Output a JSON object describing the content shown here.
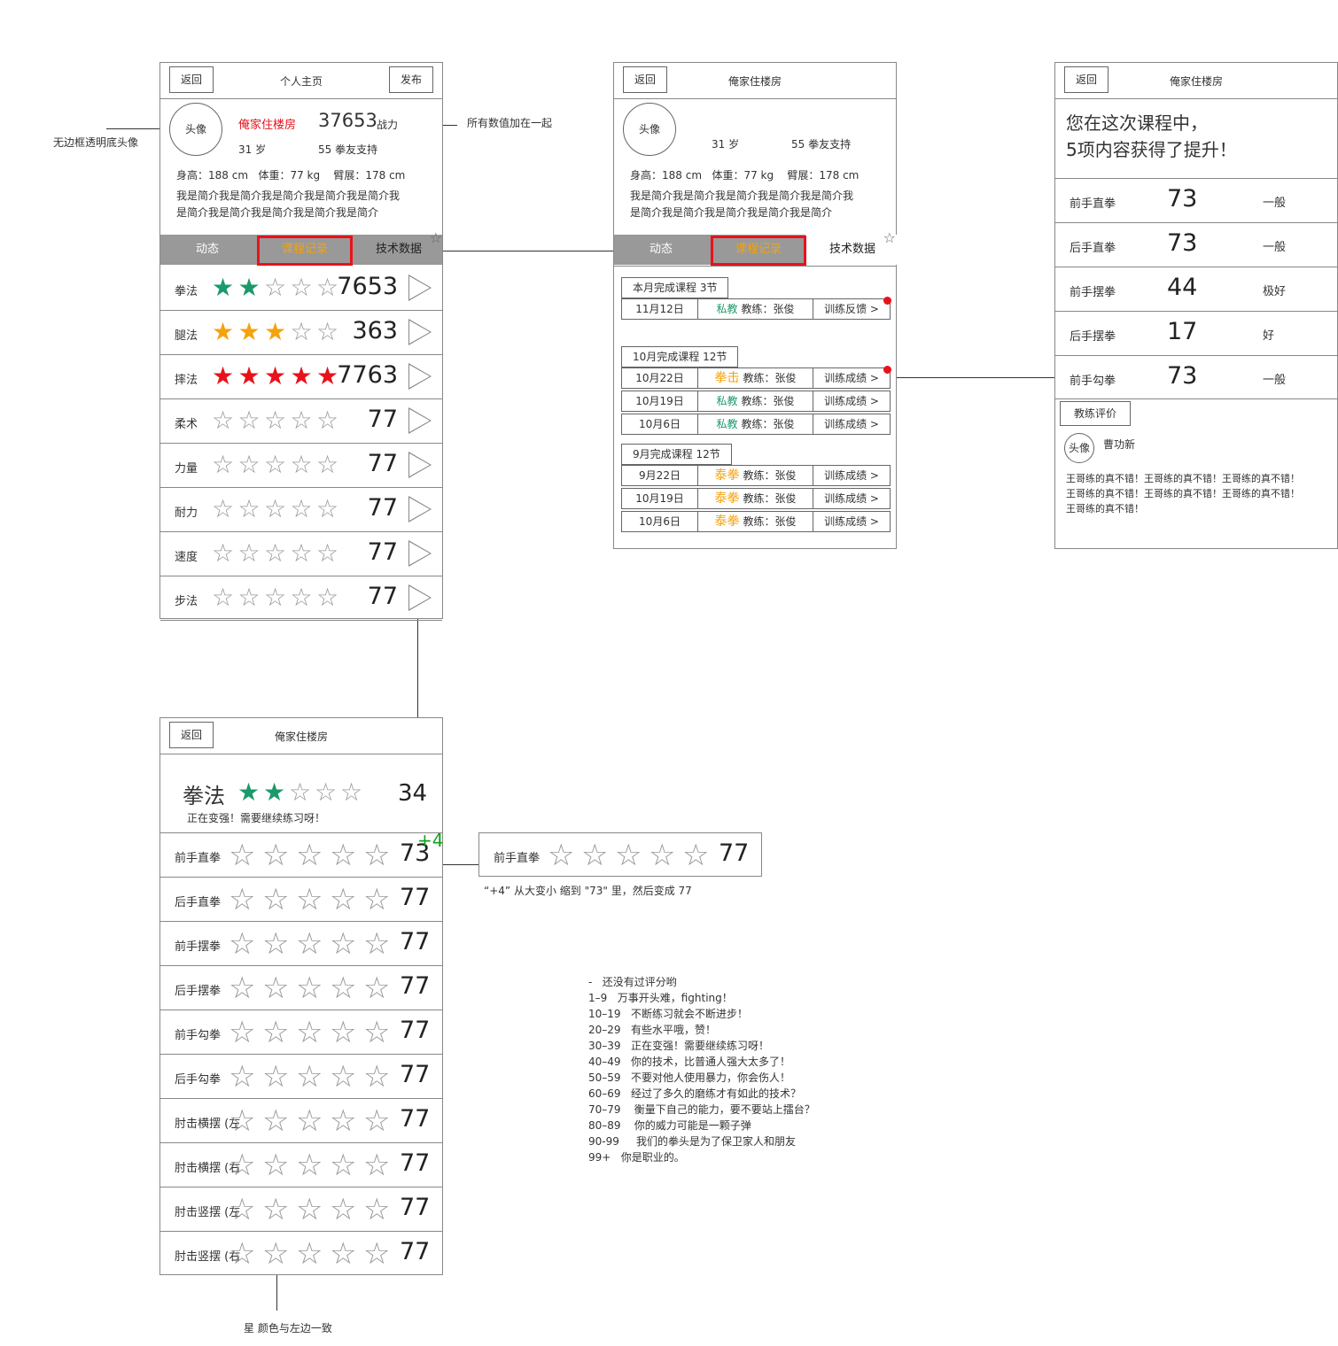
{
  "colors": {
    "accent": "#f5a20c",
    "red": "#e8121b",
    "green": "#1a9a6a",
    "tab_bg": "#999999"
  },
  "annotations": {
    "avatar_note": "无边框透明底头像",
    "sum_note": "所有数值加在一起",
    "anim_note": "“+4” 从大变小 缩到 \"73\" 里，然后变成 77",
    "star_color_note": "星 颜色与左边一致",
    "grade_list": [
      "-   还没有过评分哟",
      "1–9   万事开头难，fighting！",
      "10–19   不断练习就会不断进步！",
      "20–29   有些水平哦，赞！",
      "30–39   正在变强！需要继续练习呀！",
      "40–49   你的技术，比普通人强大太多了！",
      "50–59   不要对他人使用暴力，你会伤人！",
      "60–69   经过了多久的磨练才有如此的技术？",
      "70–79    衡量下自己的能力，要不要站上擂台？",
      "80–89    你的威力可能是一颗子弹",
      "90-99     我们的拳头是为了保卫家人和朋友",
      "99+   你是职业的。"
    ]
  },
  "profile": {
    "back": "返回",
    "title": "个人主页",
    "publish": "发布",
    "avatar": "头像",
    "name": "俺家住楼房",
    "power_value": "37653",
    "power_label": "战力",
    "age": "31 岁",
    "support": "55 拳友支持",
    "stats": "身高：188 cm   体重：77 kg    臂展：178 cm",
    "bio_1": "我是简介我是简介我是简介我是简介我是简介我",
    "bio_2": "是简介我是简介我是简介我是简介我是简介",
    "tabs": [
      "动态",
      "课程记录",
      "技术数据"
    ],
    "star_icon": "☆",
    "skills": [
      {
        "label": "拳法",
        "stars": 2,
        "color": "g",
        "value": "7653"
      },
      {
        "label": "腿法",
        "stars": 3,
        "color": "o",
        "value": "363"
      },
      {
        "label": "摔法",
        "stars": 5,
        "color": "r",
        "value": "7763"
      },
      {
        "label": "柔术",
        "stars": 0,
        "color": "e",
        "value": "77"
      },
      {
        "label": "力量",
        "stars": 0,
        "color": "e",
        "value": "77"
      },
      {
        "label": "耐力",
        "stars": 0,
        "color": "e",
        "value": "77"
      },
      {
        "label": "速度",
        "stars": 0,
        "color": "e",
        "value": "77"
      },
      {
        "label": "步法",
        "stars": 0,
        "color": "e",
        "value": "77"
      }
    ]
  },
  "courses": {
    "back": "返回",
    "title": "俺家住楼房",
    "avatar": "头像",
    "age": "31 岁",
    "support": "55 拳友支持",
    "stats": "身高：188 cm   体重：77 kg    臂展：178 cm",
    "bio_1": "我是简介我是简介我是简介我是简介我是简介我",
    "bio_2": "是简介我是简介我是简介我是简介我是简介",
    "tabs": [
      "动态",
      "课程记录",
      "技术数据"
    ],
    "star_icon": "☆",
    "groups": [
      {
        "header": "本月完成课程  3节",
        "rows": [
          {
            "date": "11月12日",
            "type": "私教",
            "type_color": "green",
            "coach": "教练：张俊",
            "action": "训练反馈 >",
            "dot": true
          }
        ]
      },
      {
        "header": "10月完成课程  12节",
        "rows": [
          {
            "date": "10月22日",
            "type": "拳击",
            "type_color": "orange",
            "coach": "教练：张俊",
            "action": "训练成绩 >",
            "dot": true
          },
          {
            "date": "10月19日",
            "type": "私教",
            "type_color": "green",
            "coach": "教练：张俊",
            "action": "训练成绩 >",
            "dot": false
          },
          {
            "date": "10月6日",
            "type": "私教",
            "type_color": "green",
            "coach": "教练：张俊",
            "action": "训练成绩 >",
            "dot": false
          }
        ]
      },
      {
        "header": "9月完成课程  12节",
        "rows": [
          {
            "date": "9月22日",
            "type": "泰拳",
            "type_color": "orange",
            "coach": "教练：张俊",
            "action": "训练成绩 >",
            "dot": false
          },
          {
            "date": "10月19日",
            "type": "泰拳",
            "type_color": "orange",
            "coach": "教练：张俊",
            "action": "训练成绩 >",
            "dot": false
          },
          {
            "date": "10月6日",
            "type": "泰拳",
            "type_color": "orange",
            "coach": "教练：张俊",
            "action": "训练成绩 >",
            "dot": false
          }
        ]
      }
    ]
  },
  "result": {
    "back": "返回",
    "title": "俺家住楼房",
    "headline_1": "您在这次课程中，",
    "headline_2": "5项内容获得了提升！",
    "items": [
      {
        "label": "前手直拳",
        "value": "73",
        "grade": "一般"
      },
      {
        "label": "后手直拳",
        "value": "73",
        "grade": "一般"
      },
      {
        "label": "前手摆拳",
        "value": "44",
        "grade": "极好"
      },
      {
        "label": "后手摆拳",
        "value": "17",
        "grade": "好"
      },
      {
        "label": "前手勾拳",
        "value": "73",
        "grade": "一般"
      }
    ],
    "review_tab": "教练评价",
    "avatar": "头像",
    "coach": "曹功新",
    "comment_1": "王哥练的真不错！王哥练的真不错！王哥练的真不错！",
    "comment_2": "王哥练的真不错！王哥练的真不错！王哥练的真不错！",
    "comment_3": "王哥练的真不错！"
  },
  "detail": {
    "back": "返回",
    "title": "俺家住楼房",
    "skill": "拳法",
    "skill_stars": 2,
    "skill_value": "34",
    "skill_msg": "正在变强！需要继续练习呀！",
    "plus": "+4",
    "items": [
      {
        "label": "前手直拳",
        "value": "73"
      },
      {
        "label": "后手直拳",
        "value": "77"
      },
      {
        "label": "前手摆拳",
        "value": "77"
      },
      {
        "label": "后手摆拳",
        "value": "77"
      },
      {
        "label": "前手勾拳",
        "value": "77"
      },
      {
        "label": "后手勾拳",
        "value": "77"
      },
      {
        "label": "肘击横摆 (左",
        "value": "77"
      },
      {
        "label": "肘击横摆 (右",
        "value": "77"
      },
      {
        "label": "肘击竖摆 (左",
        "value": "77"
      },
      {
        "label": "肘击竖摆 (右",
        "value": "77"
      }
    ],
    "popup": {
      "label": "前手直拳",
      "value": "77"
    }
  }
}
